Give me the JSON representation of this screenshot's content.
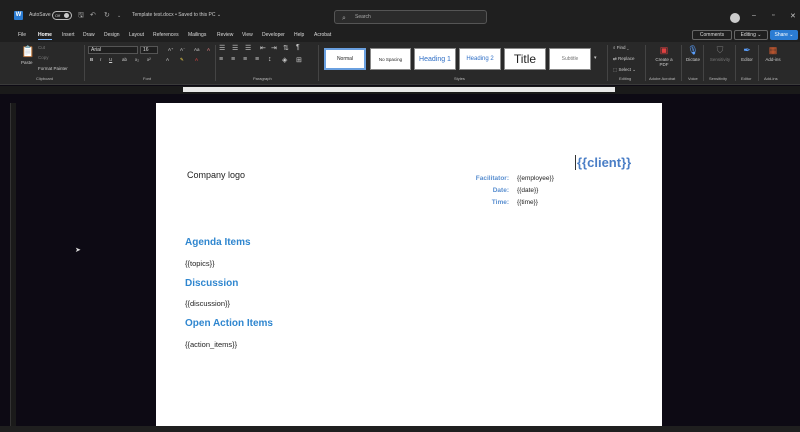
{
  "titlebar": {
    "app_logo": "W",
    "autosave_label": "AutoSave",
    "autosave_state": "Off",
    "doc_title": "Template test.docx • Saved to this PC ⌄",
    "search_placeholder": "Search"
  },
  "menu": {
    "tabs": [
      "File",
      "Home",
      "Insert",
      "Draw",
      "Design",
      "Layout",
      "References",
      "Mailings",
      "Review",
      "View",
      "Developer",
      "Help",
      "Acrobat"
    ],
    "active_tab": "Home",
    "comments_label": "Comments",
    "editing_label": "Editing ⌄",
    "share_label": "Share ⌄"
  },
  "ribbon": {
    "clipboard": {
      "paste_label": "Paste",
      "cut_label": "Cut",
      "copy_label": "Copy",
      "format_painter_label": "Format Painter",
      "group_label": "Clipboard"
    },
    "font": {
      "font_name": "Arial",
      "font_size": "16",
      "group_label": "Font"
    },
    "paragraph": {
      "group_label": "Paragraph"
    },
    "styles": {
      "group_label": "Styles",
      "items": [
        {
          "label": "Normal",
          "color": "#222222"
        },
        {
          "label": "No Spacing",
          "color": "#222222"
        },
        {
          "label": "Heading 1",
          "color": "#2f6fc6"
        },
        {
          "label": "Heading 2",
          "color": "#2f6fc6"
        },
        {
          "label": "Title",
          "color": "#111111"
        },
        {
          "label": "Subtitle",
          "color": "#777777"
        }
      ]
    },
    "editing": {
      "find_label": "Find ⌄",
      "replace_label": "Replace",
      "select_label": "Select ⌄",
      "group_label": "Editing"
    },
    "acrobat": {
      "create_pdf_label": "Create a PDF",
      "group_label": "Adobe Acrobat"
    },
    "voice": {
      "dictate_label": "Dictate",
      "group_label": "Voice"
    },
    "sensitivity": {
      "label": "Sensitivity",
      "group_label": "Sensitivity"
    },
    "editor": {
      "label": "Editor",
      "group_label": "Editor"
    },
    "addins": {
      "label": "Add-ins",
      "group_label": "Add-ins"
    }
  },
  "document": {
    "company_logo": "Company logo",
    "client": "{{client}}",
    "facilitator_label": "Facilitator:",
    "facilitator_value": "{{employee}}",
    "date_label": "Date:",
    "date_value": "{{date}}",
    "time_label": "Time:",
    "time_value": "{{time}}",
    "sections": [
      {
        "heading": "Agenda Items",
        "body": "{{topics}}"
      },
      {
        "heading": "Discussion",
        "body": "{{discussion}}"
      },
      {
        "heading": "Open Action Items",
        "body": "{{action_items}}"
      }
    ]
  },
  "colors": {
    "accent": "#2b7cd3",
    "heading": "#2f86cf",
    "client": "#4a7ec6",
    "label": "#5a8fd0"
  }
}
